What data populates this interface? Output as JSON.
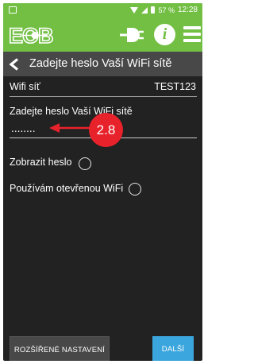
{
  "status_bar": {
    "battery": "57 %",
    "time": "12:28"
  },
  "app_bar": {
    "logo_text": "EOB",
    "icons": [
      "plug-icon",
      "info-icon",
      "menu-icon"
    ],
    "info_glyph": "i"
  },
  "title_bar": {
    "title": "Zadejte heslo Vaší WiFi sítě"
  },
  "form": {
    "wifi_label": "Wifi síť",
    "wifi_value": "TEST123",
    "password_label": "Zadejte heslo Vaší WiFi sítě",
    "password_value": "........",
    "show_password_label": "Zobrazit heslo",
    "open_wifi_label": "Používám otevřenou WiFi"
  },
  "annotation": {
    "step": "2.8"
  },
  "buttons": {
    "advanced": "ROZŠÍŘENÉ NASTAVENÍ",
    "next": "DALŠÍ"
  },
  "colors": {
    "accent_green": "#72bf44",
    "background": "#222222",
    "title_bar": "#484848",
    "next_button": "#3ba6dd",
    "annotation_red": "#e8222b"
  }
}
